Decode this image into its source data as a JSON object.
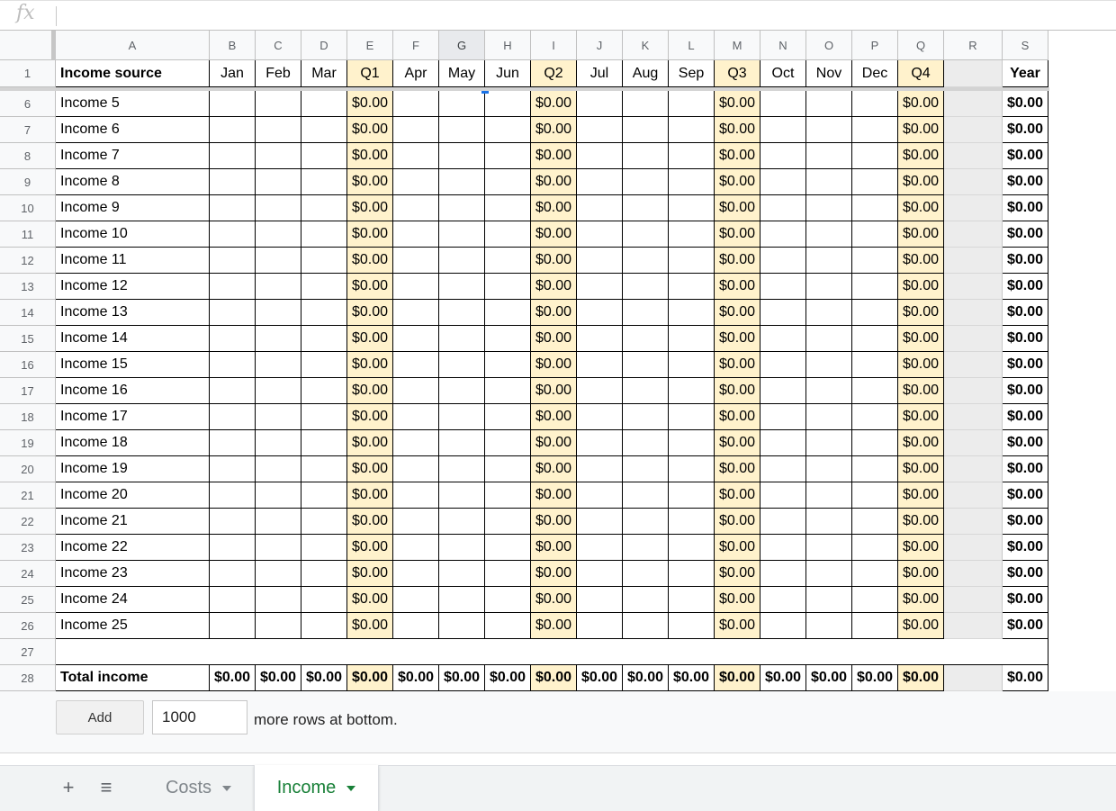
{
  "formula_bar": {
    "fx_label": "fx",
    "value": ""
  },
  "columns": [
    "A",
    "B",
    "C",
    "D",
    "E",
    "F",
    "G",
    "H",
    "I",
    "J",
    "K",
    "L",
    "M",
    "N",
    "O",
    "P",
    "Q",
    "R",
    "S"
  ],
  "selected_column": "G",
  "header_row": {
    "row_number": "1",
    "cells": [
      "Income source",
      "Jan",
      "Feb",
      "Mar",
      "Q1",
      "Apr",
      "May",
      "Jun",
      "Q2",
      "Jul",
      "Aug",
      "Sep",
      "Q3",
      "Oct",
      "Nov",
      "Dec",
      "Q4",
      "",
      "Year"
    ]
  },
  "income_rows": [
    {
      "row_number": "6",
      "label": "Income 5"
    },
    {
      "row_number": "7",
      "label": "Income 6"
    },
    {
      "row_number": "8",
      "label": "Income 7"
    },
    {
      "row_number": "9",
      "label": "Income 8"
    },
    {
      "row_number": "10",
      "label": "Income 9"
    },
    {
      "row_number": "11",
      "label": "Income 10"
    },
    {
      "row_number": "12",
      "label": "Income 11"
    },
    {
      "row_number": "13",
      "label": "Income 12"
    },
    {
      "row_number": "14",
      "label": "Income 13"
    },
    {
      "row_number": "15",
      "label": "Income 14"
    },
    {
      "row_number": "16",
      "label": "Income 15"
    },
    {
      "row_number": "17",
      "label": "Income 16"
    },
    {
      "row_number": "18",
      "label": "Income 17"
    },
    {
      "row_number": "19",
      "label": "Income 18"
    },
    {
      "row_number": "20",
      "label": "Income 19"
    },
    {
      "row_number": "21",
      "label": "Income 20"
    },
    {
      "row_number": "22",
      "label": "Income 21"
    },
    {
      "row_number": "23",
      "label": "Income 22"
    },
    {
      "row_number": "24",
      "label": "Income 23"
    },
    {
      "row_number": "25",
      "label": "Income 24"
    },
    {
      "row_number": "26",
      "label": "Income 25"
    }
  ],
  "row_value": "$0.00",
  "empty_row_number": "27",
  "total_row": {
    "row_number": "28",
    "label": "Total income",
    "value": "$0.00"
  },
  "add_rows": {
    "button_label": "Add",
    "count": "1000",
    "suffix": "more rows at bottom."
  },
  "sheet_tabs": [
    {
      "label": "Costs",
      "active": false
    },
    {
      "label": "Income",
      "active": true
    }
  ],
  "colors": {
    "quarter_fill": "#fff2cc",
    "active_tab": "#188038",
    "selection": "#1a73e8"
  }
}
